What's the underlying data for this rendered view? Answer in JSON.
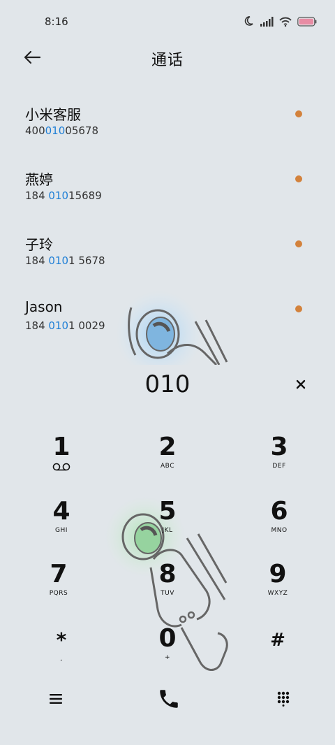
{
  "status": {
    "time": "8:16"
  },
  "header": {
    "title": "通话"
  },
  "contacts": [
    {
      "name": "小米客服",
      "num_pre": "400",
      "num_hl": "010",
      "num_post": "05678"
    },
    {
      "name": "燕婷",
      "num_pre": "184 ",
      "num_hl": "010",
      "num_post": "15689"
    },
    {
      "name": "子玲",
      "num_pre": "184 ",
      "num_hl": "010",
      "num_post": "1 5678"
    },
    {
      "name": "Jason",
      "num_pre": "184 ",
      "num_hl": "010",
      "num_post": "1 0029"
    }
  ],
  "dialer": {
    "number": "010",
    "clear_symbol": "×",
    "keys": [
      {
        "digit": "1",
        "letters": ""
      },
      {
        "digit": "2",
        "letters": "ABC"
      },
      {
        "digit": "3",
        "letters": "DEF"
      },
      {
        "digit": "4",
        "letters": "GHI"
      },
      {
        "digit": "5",
        "letters": "JKL"
      },
      {
        "digit": "6",
        "letters": "MNO"
      },
      {
        "digit": "7",
        "letters": "PQRS"
      },
      {
        "digit": "8",
        "letters": "TUV"
      },
      {
        "digit": "9",
        "letters": "WXYZ"
      },
      {
        "digit": "*",
        "letters": ","
      },
      {
        "digit": "0",
        "letters": "+"
      },
      {
        "digit": "#",
        "letters": ""
      }
    ]
  },
  "icons": {
    "back": "arrow-left-icon",
    "clear": "close-icon",
    "voicemail": "voicemail-icon",
    "menu": "menu-icon",
    "call": "phone-icon",
    "dialpad": "dialpad-icon",
    "status": [
      "moon-icon",
      "signal-icon",
      "wifi-icon",
      "battery-icon"
    ]
  },
  "colors": {
    "background": "#e1e6ea",
    "highlight": "#1f7fd6",
    "dot": "#d3823c",
    "battery": "#e88ca4"
  }
}
